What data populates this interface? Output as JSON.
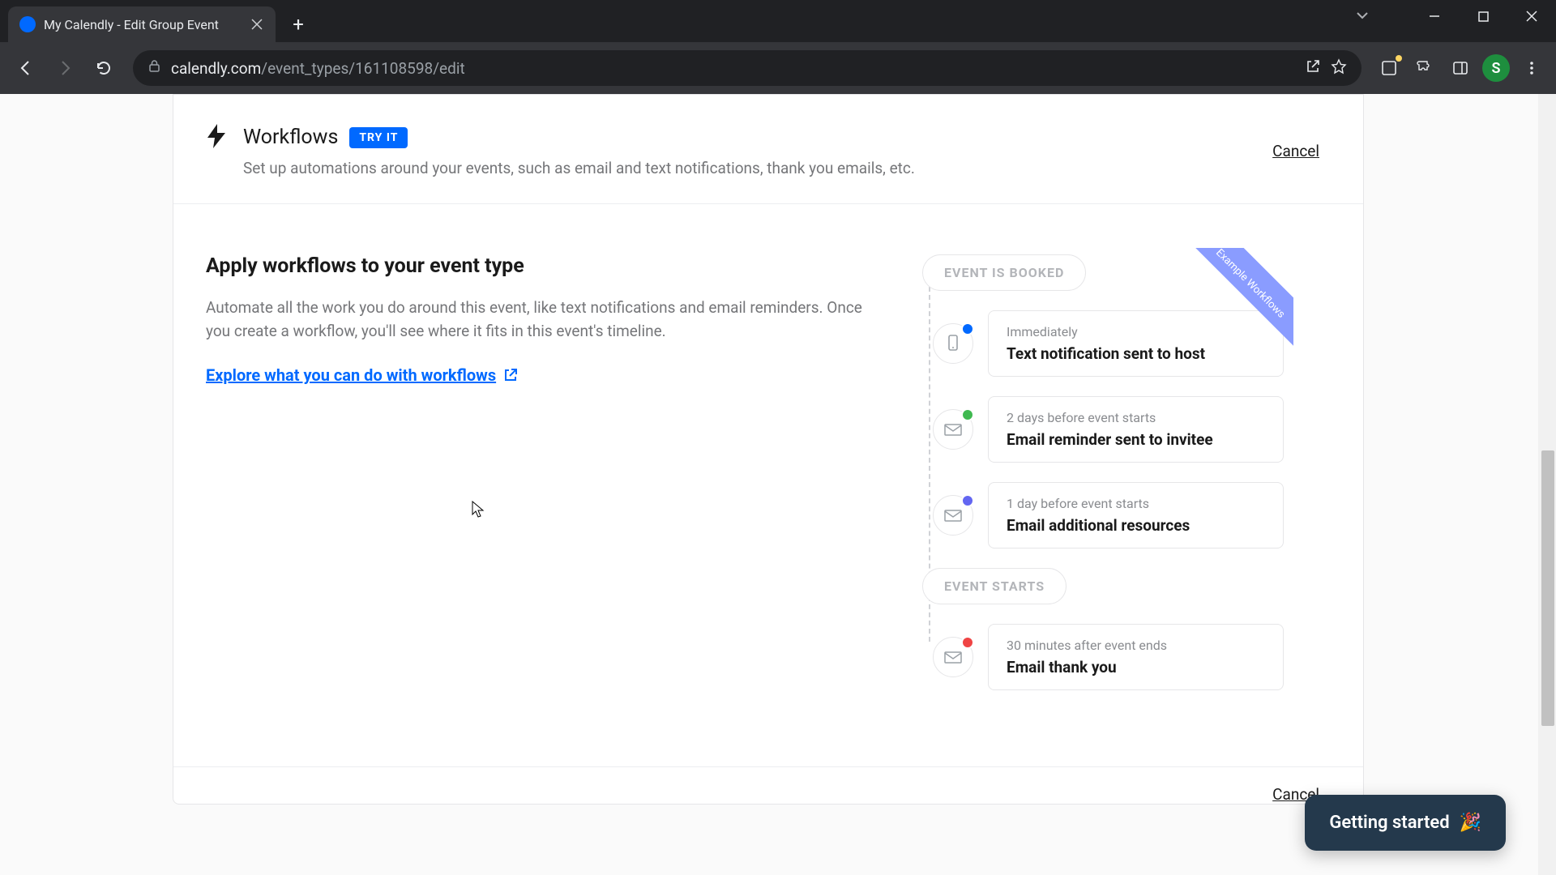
{
  "browser": {
    "tab_title": "My Calendly - Edit Group Event",
    "url_display_host": "calendly.com",
    "url_display_path": "/event_types/161108598/edit",
    "avatar_letter": "S"
  },
  "header": {
    "title": "Workflows",
    "badge": "TRY IT",
    "subtitle": "Set up automations around your events, such as email and text notifications, thank you emails, etc.",
    "cancel": "Cancel"
  },
  "body": {
    "heading": "Apply workflows to your event type",
    "paragraph": "Automate all the work you do around this event, like text notifications and email reminders. Once you create a workflow, you'll see where it fits in this event's timeline.",
    "explore_link": "Explore what you can do with workflows"
  },
  "timeline": {
    "ribbon": "Example Workflows",
    "booked_label": "EVENT IS BOOKED",
    "starts_label": "EVENT STARTS",
    "steps": [
      {
        "when": "Immediately",
        "what": "Text notification sent to host"
      },
      {
        "when": "2 days before event starts",
        "what": "Email reminder sent to invitee"
      },
      {
        "when": "1 day before event starts",
        "what": "Email additional resources"
      },
      {
        "when": "30 minutes after event ends",
        "what": "Email thank you"
      }
    ]
  },
  "footer": {
    "cancel": "Cancel"
  },
  "help": {
    "label": "Getting started",
    "emoji": "🎉"
  }
}
